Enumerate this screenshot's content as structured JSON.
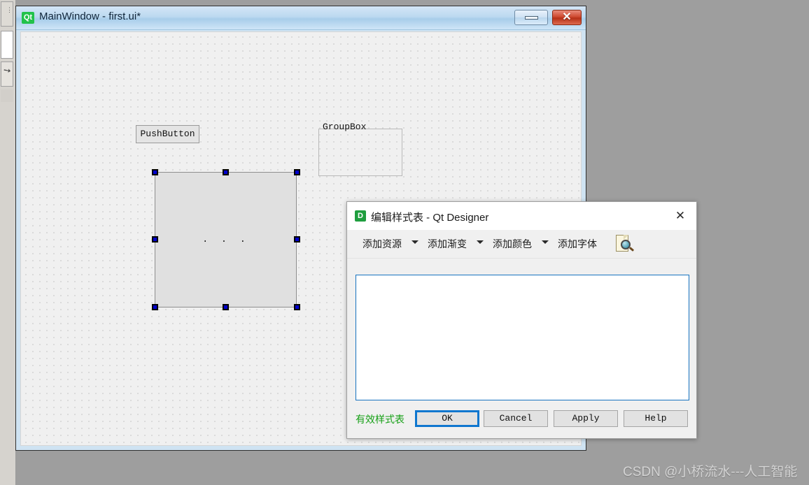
{
  "left_panel": {
    "dots_icon": "grip-dots-icon",
    "arrow_icon": "arrow-cursor-icon"
  },
  "main_window": {
    "icon_label": "Qt",
    "title": "MainWindow - first.ui*",
    "minimize_label": "",
    "close_label": "✕",
    "canvas": {
      "push_button_label": "PushButton",
      "group_box_label": "GroupBox",
      "selected_widget_label": ". . ."
    }
  },
  "dialog": {
    "icon_label": "D",
    "title": "编辑样式表 - Qt Designer",
    "close_label": "✕",
    "toolbar": {
      "add_resource": "添加资源",
      "add_gradient": "添加渐变",
      "add_color": "添加颜色",
      "add_font": "添加字体",
      "preview_icon": "document-magnifier-icon"
    },
    "editor": {
      "value": "",
      "placeholder": ""
    },
    "status_text": "有效样式表",
    "buttons": {
      "ok": "OK",
      "cancel": "Cancel",
      "apply": "Apply",
      "help": "Help"
    },
    "accent_color": "#0f77cf",
    "status_color": "#16a016"
  },
  "watermark": {
    "text": "CSDN @小桥流水---人工智能"
  }
}
